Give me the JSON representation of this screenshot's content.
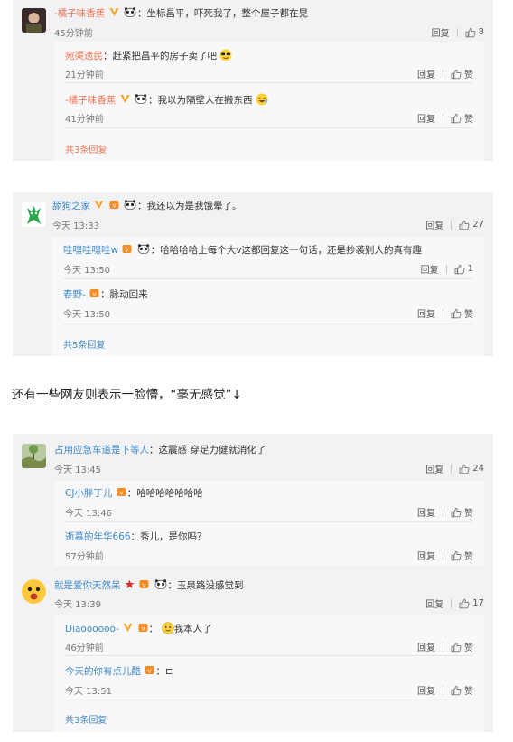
{
  "labels": {
    "reply": "回复",
    "like": "赞"
  },
  "cards": [
    {
      "user": "-橘子味香蕉",
      "text": "坐标昌平，吓死我了，整个屋子都在晃",
      "time": "45分钟前",
      "likes": "8",
      "replies": [
        {
          "user": "宛渠遗民",
          "text": "赶紧把昌平的房子卖了吧",
          "time": "21分钟前",
          "likes": "赞"
        },
        {
          "user": "-橘子味香蕉",
          "text": "我以为隔壁人在搬东西",
          "time": "41分钟前",
          "likes": "赞"
        }
      ],
      "more": "共3条回复"
    },
    {
      "user": "舔狗之家",
      "text": "我还以为是我饿晕了。",
      "time": "今天 13:33",
      "likes": "27",
      "replies": [
        {
          "user": "哇嘿哇嘿哇w",
          "text": "哈哈哈哈上每个大v这都回复这一句话，还是抄袭别人的真有趣",
          "time": "今天 13:50",
          "likes": "1"
        },
        {
          "user": "春野-",
          "text": "脉动回来",
          "time": "今天 13:50",
          "likes": "赞"
        }
      ],
      "more": "共5条回复"
    },
    {
      "user": "占用应急车道是下等人",
      "text": "这震感 穿足力健就消化了",
      "time": "今天 13:45",
      "likes": "24",
      "replies": [
        {
          "user": "CJ小胖丁儿",
          "text": "哈哈哈哈哈哈哈",
          "time": "今天 13:46",
          "likes": "赞"
        },
        {
          "user": "逝慕的年华666",
          "text": "秀儿，是你吗？",
          "time": "57分钟前",
          "likes": "赞"
        }
      ]
    },
    {
      "user": "就是爱你天然呆",
      "text": "玉泉路没感觉到",
      "time": "今天 13:39",
      "likes": "17",
      "replies": [
        {
          "user": "Diaoooooo-",
          "text": "我本人了",
          "time": "46分钟前",
          "likes": "赞"
        },
        {
          "user": "今天的你有点儿酷",
          "text": "⊏",
          "time": "今天 13:51",
          "likes": "赞"
        }
      ],
      "more": "共3条回复"
    }
  ],
  "caption": "还有一些网友则表示一脸懵，“毫无感觉”↓",
  "colors": {
    "username_orange": "#eb7350",
    "username_blue": "#3d89c9",
    "card_bg": "#f2f2f5",
    "sub_bg": "#f8f8fa"
  }
}
